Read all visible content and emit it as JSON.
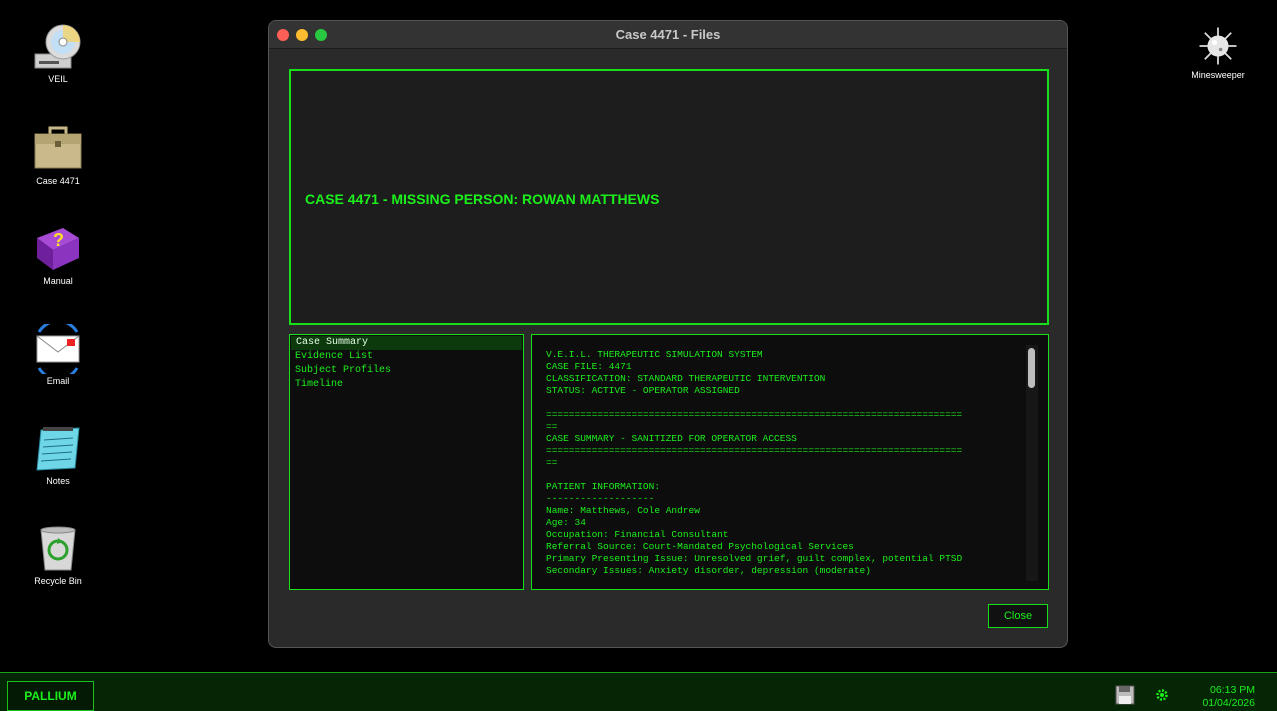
{
  "desktop": {
    "icons": [
      {
        "label": "VEIL",
        "icon": "cd-drive-icon"
      },
      {
        "label": "Case 4471",
        "icon": "briefcase-icon"
      },
      {
        "label": "Manual",
        "icon": "help-book-icon"
      },
      {
        "label": "Email",
        "icon": "email-icon"
      },
      {
        "label": "Notes",
        "icon": "notepad-icon"
      },
      {
        "label": "Recycle Bin",
        "icon": "recycle-bin-icon"
      },
      {
        "label": "Minesweeper",
        "icon": "mine-icon"
      }
    ]
  },
  "window": {
    "title": "Case 4471 - Files",
    "banner": "CASE 4471 - MISSING PERSON: ROWAN MATTHEWS",
    "nav_items": [
      "Case Summary",
      "Evidence List",
      "Subject Profiles",
      "Timeline"
    ],
    "selected_nav": "Case Summary",
    "content_lines": [
      "V.E.I.L. THERAPEUTIC SIMULATION SYSTEM",
      "CASE FILE: 4471",
      "CLASSIFICATION: STANDARD THERAPEUTIC INTERVENTION",
      "STATUS: ACTIVE - OPERATOR ASSIGNED",
      "",
      "=========================================================================",
      "==",
      "CASE SUMMARY - SANITIZED FOR OPERATOR ACCESS",
      "=========================================================================",
      "==",
      "",
      "PATIENT INFORMATION:",
      "-------------------",
      "Name: Matthews, Cole Andrew",
      "Age: 34",
      "Occupation: Financial Consultant",
      "Referral Source: Court-Mandated Psychological Services",
      "Primary Presenting Issue: Unresolved grief, guilt complex, potential PTSD",
      "Secondary Issues: Anxiety disorder, depression (moderate)"
    ],
    "close_label": "Close"
  },
  "taskbar": {
    "start_label": "PALLIUM",
    "time": "06:13 PM",
    "date": "01/04/2026"
  }
}
